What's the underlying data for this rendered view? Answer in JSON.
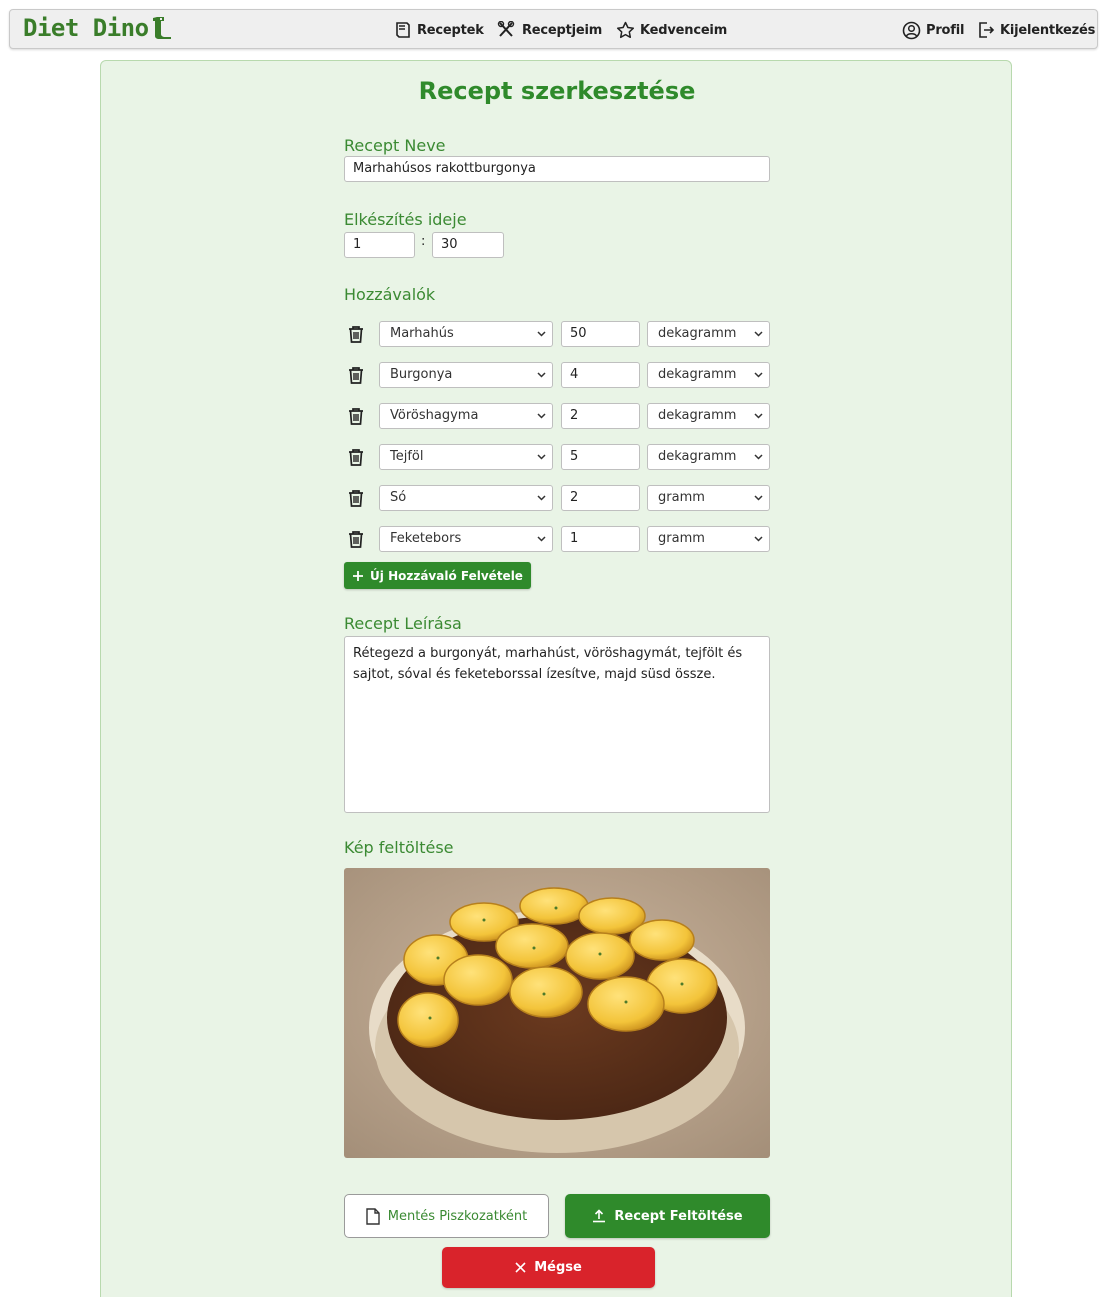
{
  "app": {
    "brand": "Diet Dino"
  },
  "nav": {
    "recipes": "Receptek",
    "my_recipes": "Receptjeim",
    "favorites": "Kedvenceim",
    "profile": "Profil",
    "logout": "Kijelentkezés"
  },
  "form": {
    "title": "Recept szerkesztése",
    "name_label": "Recept Neve",
    "name_value": "Marhahúsos rakottburgonya",
    "time_label": "Elkészítés ideje",
    "time_hours": "1",
    "time_separator": ":",
    "time_minutes": "30",
    "ingredients_label": "Hozzávalók",
    "ingredients": [
      {
        "name": "Marhahús",
        "amount": "50",
        "unit": "dekagramm"
      },
      {
        "name": "Burgonya",
        "amount": "4",
        "unit": "dekagramm"
      },
      {
        "name": "Vöröshagyma",
        "amount": "2",
        "unit": "dekagramm"
      },
      {
        "name": "Tejföl",
        "amount": "5",
        "unit": "dekagramm"
      },
      {
        "name": "Só",
        "amount": "2",
        "unit": "gramm"
      },
      {
        "name": "Feketebors",
        "amount": "1",
        "unit": "gramm"
      }
    ],
    "add_ingredient_button": "Új Hozzávaló Felvétele",
    "description_label": "Recept Leírása",
    "description_value": "Rétegezd a burgonyát, marhahúst, vöröshagymát, tejfölt és sajtot, sóval és feketeborssal ízesítve, majd süsd össze.",
    "image_label": "Kép feltöltése",
    "save_draft_button": "Mentés Piszkozatként",
    "upload_button": "Recept Feltöltése",
    "cancel_button": "Mégse"
  },
  "colors": {
    "brand_green": "#2f8a2b",
    "label_green": "#3b8a33",
    "card_bg": "#e9f4e6",
    "cancel_red": "#d9232b"
  }
}
